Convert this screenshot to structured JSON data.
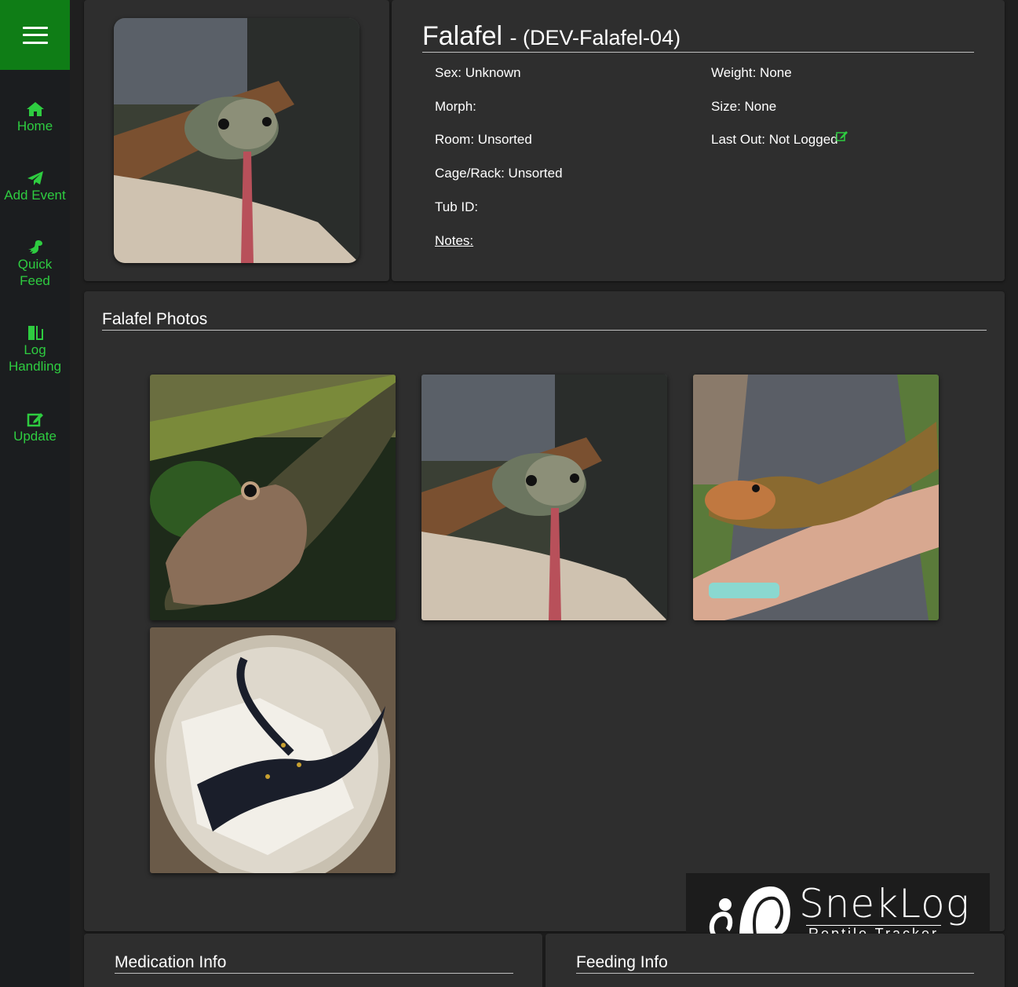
{
  "sidebar": {
    "items": [
      {
        "label": "Home",
        "icon": "home-icon"
      },
      {
        "label": "Add Event",
        "icon": "paper-plane-icon"
      },
      {
        "label": "Quick Feed",
        "icon": "dinosaur-icon"
      },
      {
        "label": "Log Handling",
        "icon": "door-exit-icon"
      },
      {
        "label": "Update",
        "icon": "edit-icon"
      }
    ]
  },
  "animal": {
    "name": "Falafel",
    "id_text": "- (DEV-Falafel-04)",
    "fields_left": [
      {
        "key": "sex",
        "text": "Sex: Unknown"
      },
      {
        "key": "morph",
        "text": "Morph:"
      },
      {
        "key": "room",
        "text": "Room: Unsorted"
      },
      {
        "key": "cage",
        "text": "Cage/Rack: Unsorted"
      },
      {
        "key": "tub",
        "text": "Tub ID:"
      },
      {
        "key": "notes",
        "text": "Notes:"
      }
    ],
    "fields_right": [
      {
        "key": "weight",
        "text": "Weight: None"
      },
      {
        "key": "size",
        "text": "Size: None"
      },
      {
        "key": "last_out",
        "text": "Last Out: Not Logged"
      }
    ]
  },
  "photos": {
    "title": "Falafel Photos",
    "count": 4
  },
  "sections": {
    "medication_title": "Medication Info",
    "feeding_title": "Feeding Info"
  },
  "logo": {
    "title": "SnekLog",
    "subtitle": "Reptile Tracker"
  },
  "colors": {
    "accent": "#2ecc40",
    "menu_bg": "#0f7d16",
    "panel_bg": "#2e2e2e",
    "page_bg": "#1f1f1f"
  }
}
